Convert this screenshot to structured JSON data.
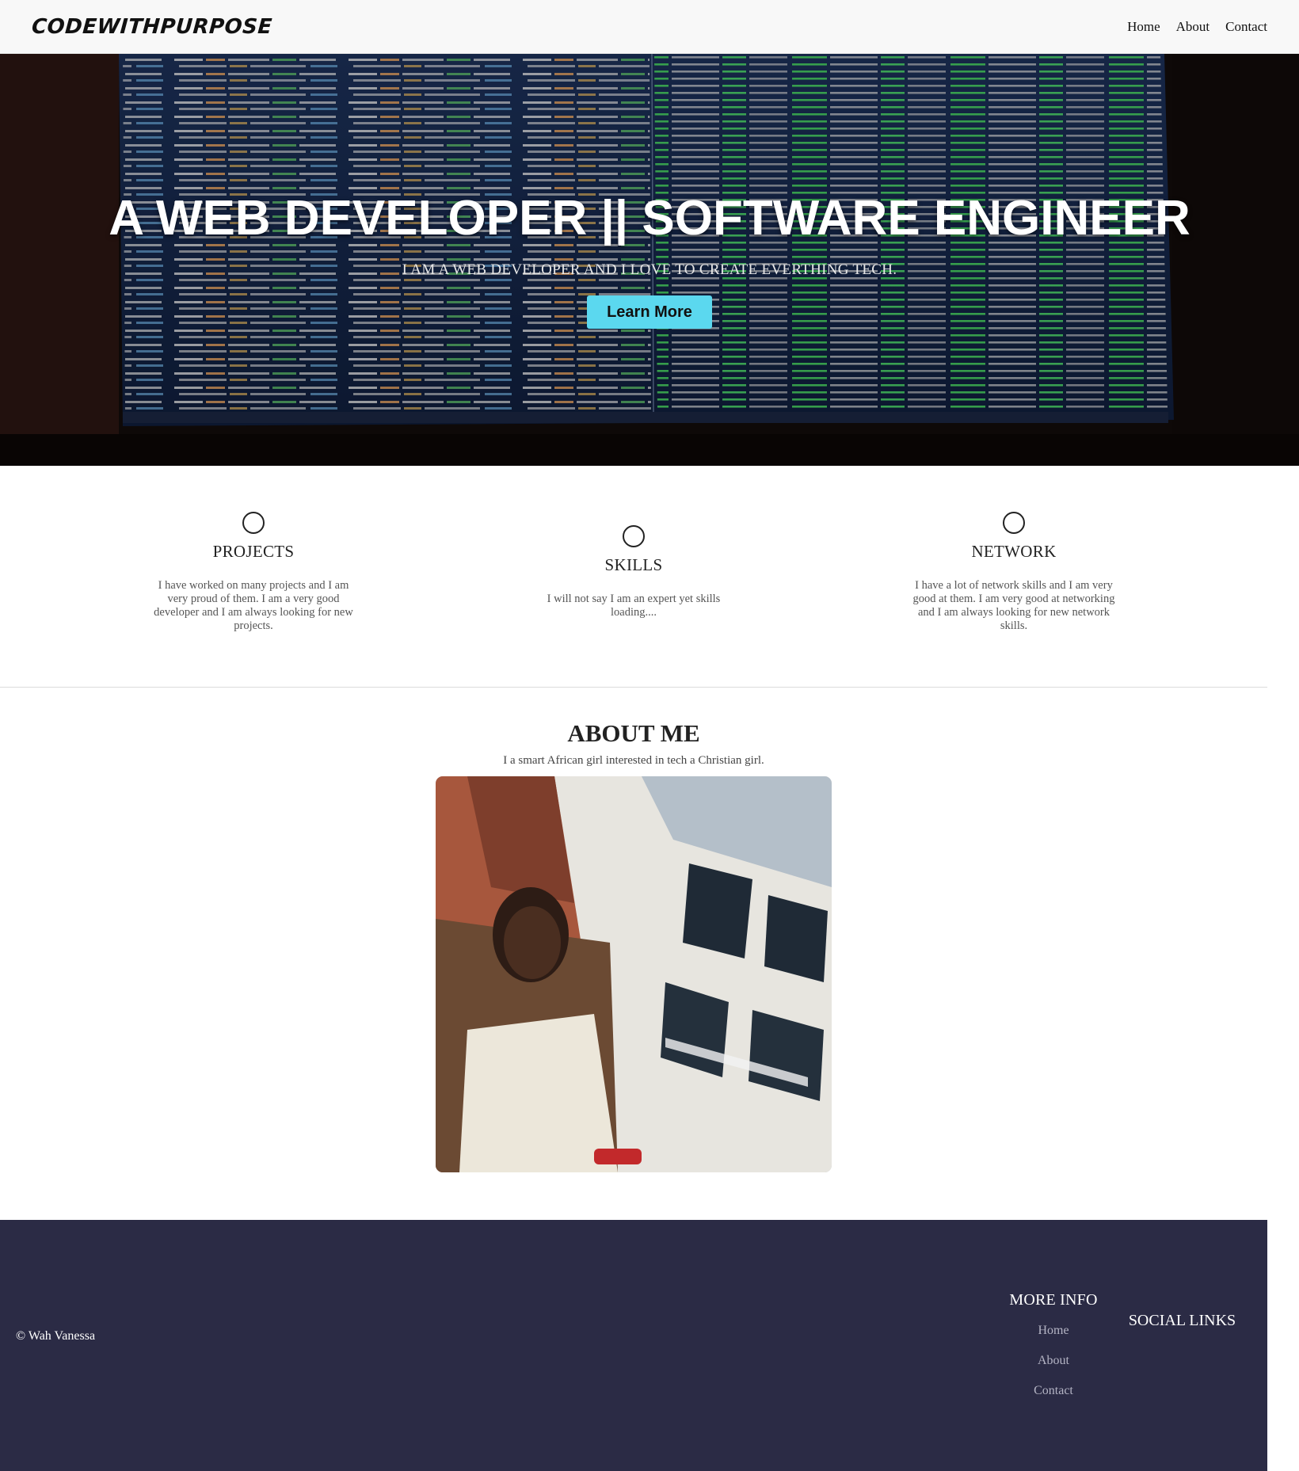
{
  "header": {
    "brand": "CODEWITHPURPOSE",
    "nav": [
      "Home",
      "About",
      "Contact"
    ]
  },
  "hero": {
    "title": "A WEB DEVELOPER || SOFTWARE ENGINEER",
    "subtitle": "I AM A WEB DEVELOPER AND I LOVE TO CREATE EVERTHING TECH.",
    "button": "Learn More",
    "button_color": "#5bd8ef"
  },
  "features": [
    {
      "icon": "circle-icon",
      "title": "PROJECTS",
      "text": "I have worked on many projects and I am very proud of them. I am a very good developer and I am always looking for new projects."
    },
    {
      "icon": "circle-icon",
      "title": "SKILLS",
      "text": "I will not say I am an expert yet skills loading...."
    },
    {
      "icon": "circle-icon",
      "title": "NETWORK",
      "text": "I have a lot of network skills and I am very good at them. I am very good at networking and I am always looking for new network skills."
    }
  ],
  "about": {
    "title": "ABOUT ME",
    "subtitle": "I a smart African girl interested in tech a Christian girl."
  },
  "footer": {
    "copyright": "© Wah Vanessa",
    "more_info": {
      "title": "MORE INFO",
      "links": [
        "Home",
        "About",
        "Contact"
      ]
    },
    "social_title": "SOCIAL LINKS",
    "background": "#2b2b45"
  }
}
